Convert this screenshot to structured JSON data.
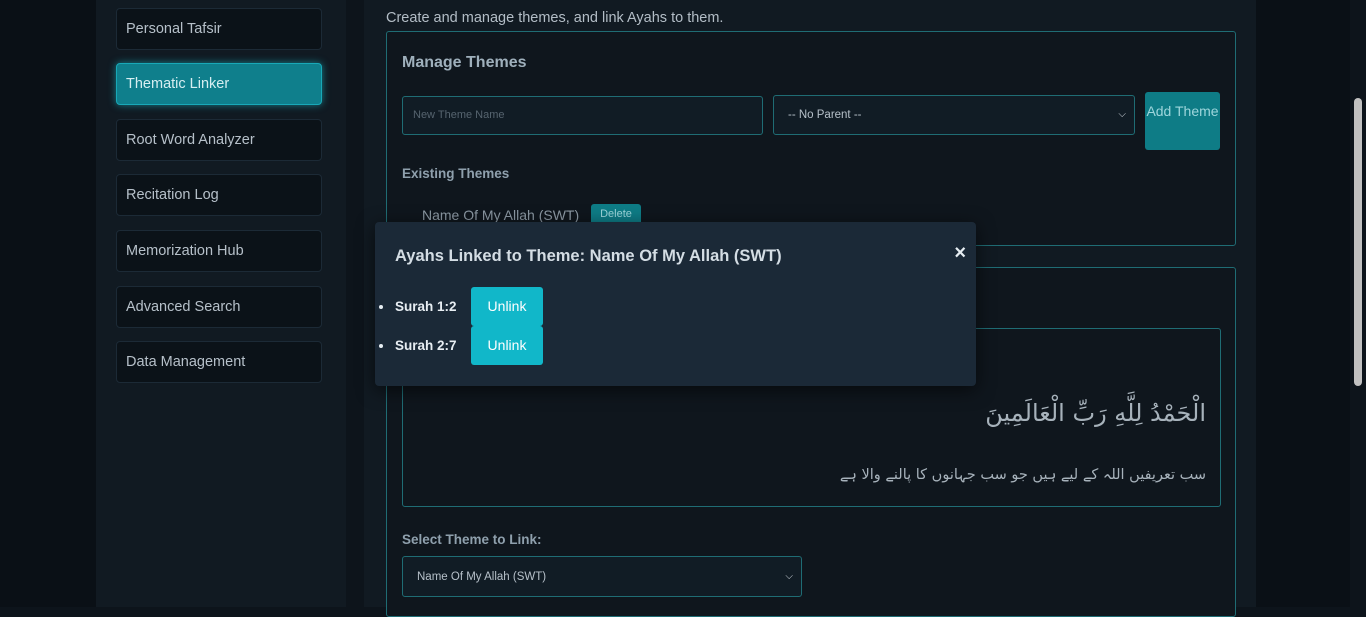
{
  "sidebar": {
    "items": [
      {
        "label": "Personal Tafsir",
        "active": false
      },
      {
        "label": "Thematic Linker",
        "active": true
      },
      {
        "label": "Root Word Analyzer",
        "active": false
      },
      {
        "label": "Recitation Log",
        "active": false
      },
      {
        "label": "Memorization Hub",
        "active": false
      },
      {
        "label": "Advanced Search",
        "active": false
      },
      {
        "label": "Data Management",
        "active": false
      }
    ]
  },
  "main": {
    "intro": "Create and manage themes, and link Ayahs to them.",
    "manage": {
      "title": "Manage Themes",
      "theme_name_placeholder": "New Theme Name",
      "parent_select": "-- No Parent --",
      "add_button": "Add Theme",
      "existing_heading": "Existing Themes",
      "themes": [
        {
          "name": "Name Of My Allah (SWT)",
          "delete_label": "Delete"
        }
      ]
    },
    "link": {
      "arabic": "الْحَمْدُ لِلَّهِ رَبِّ الْعَالَمِينَ",
      "translation": "سب تعریفیں اللہ کے لیے ہیں جو سب جہانوں کا پالنے والا ہے",
      "select_label": "Select Theme to Link:",
      "select_value": "Name Of My Allah (SWT)"
    }
  },
  "modal": {
    "title": "Ayahs Linked to Theme: Name Of My Allah (SWT)",
    "close": "×",
    "ayahs": [
      {
        "ref": "Surah 1:2",
        "unlink": "Unlink"
      },
      {
        "ref": "Surah 2:7",
        "unlink": "Unlink"
      }
    ]
  },
  "colors": {
    "accent": "#0e7c86",
    "unlink": "#11b7c9",
    "background": "#0d141b"
  }
}
